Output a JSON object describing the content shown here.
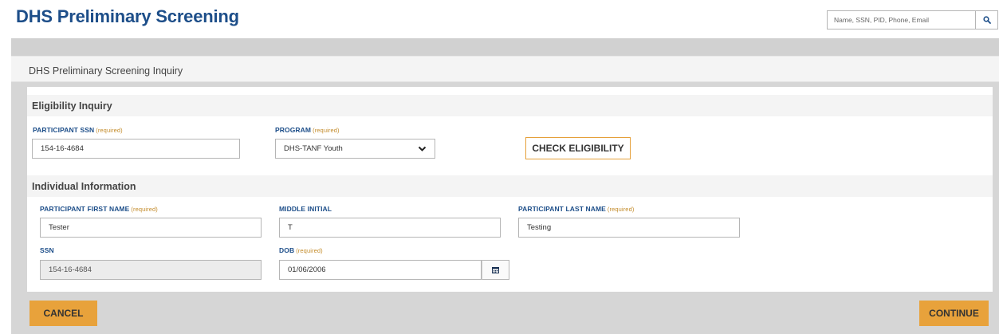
{
  "header": {
    "title": "DHS Preliminary Screening",
    "search": {
      "placeholder": "Name, SSN, PID, Phone, Email",
      "icon": "search-icon"
    }
  },
  "panel": {
    "title": "DHS Preliminary Screening Inquiry"
  },
  "eligibility": {
    "section_title": "Eligibility Inquiry",
    "ssn": {
      "label": "PARTICIPANT SSN",
      "required": "(required)",
      "value": "154-16-4684"
    },
    "program": {
      "label": "PROGRAM",
      "required": "(required)",
      "value": "DHS-TANF Youth"
    },
    "check_button": "CHECK ELIGIBILITY"
  },
  "individual": {
    "section_title": "Individual Information",
    "first_name": {
      "label": "PARTICIPANT FIRST NAME",
      "required": "(required)",
      "value": "Tester"
    },
    "middle_initial": {
      "label": "MIDDLE INITIAL",
      "value": "T"
    },
    "last_name": {
      "label": "PARTICIPANT LAST NAME",
      "required": "(required)",
      "value": "Testing"
    },
    "ssn": {
      "label": "SSN",
      "value": "154-16-4684"
    },
    "dob": {
      "label": "DOB",
      "required": "(required)",
      "value": "01/06/2006",
      "icon": "calendar-icon"
    }
  },
  "footer": {
    "cancel": "CANCEL",
    "continue": "CONTINUE"
  },
  "colors": {
    "title_blue": "#1d4e89",
    "accent_orange": "#e8a23b",
    "required_text": "#c38b2a"
  }
}
